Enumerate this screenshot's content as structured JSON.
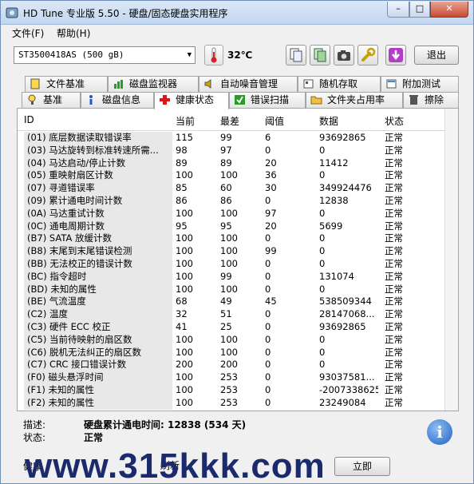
{
  "window": {
    "title": "HD Tune 专业版 5.50 - 硬盘/固态硬盘实用程序",
    "minimize_glyph": "–",
    "maximize_glyph": "□",
    "close_glyph": "✕"
  },
  "menu": {
    "items": [
      "文件(F)",
      "帮助(H)"
    ]
  },
  "toolbar": {
    "drive": "ST3500418AS  (500 gB)",
    "temperature": "32℃",
    "icons": [
      "copy-info-icon",
      "copy-screen-icon",
      "screenshot-icon",
      "options-icon",
      "save-icon"
    ],
    "exit_label": "退出"
  },
  "tabs_top": [
    {
      "label": "文件基准",
      "icon": "file-benchmark-icon"
    },
    {
      "label": "磁盘监视器",
      "icon": "disk-monitor-icon"
    },
    {
      "label": "自动噪音管理",
      "icon": "aam-icon"
    },
    {
      "label": "随机存取",
      "icon": "random-access-icon"
    },
    {
      "label": "附加测试",
      "icon": "extra-tests-icon"
    }
  ],
  "tabs_bottom": [
    {
      "label": "基准",
      "icon": "benchmark-icon"
    },
    {
      "label": "磁盘信息",
      "icon": "info-icon"
    },
    {
      "label": "健康状态",
      "icon": "health-icon",
      "active": true
    },
    {
      "label": "错误扫描",
      "icon": "error-scan-icon"
    },
    {
      "label": "文件夹占用率",
      "icon": "folder-usage-icon"
    },
    {
      "label": "擦除",
      "icon": "erase-icon"
    }
  ],
  "table": {
    "headers": [
      "ID",
      "当前",
      "最差",
      "阈值",
      "数据",
      "状态"
    ],
    "rows": [
      [
        "(01) 底层数据读取错误率",
        "115",
        "99",
        "6",
        "93692865",
        "正常"
      ],
      [
        "(03) 马达旋转到标准转速所需...",
        "98",
        "97",
        "0",
        "0",
        "正常"
      ],
      [
        "(04) 马达启动/停止计数",
        "89",
        "89",
        "20",
        "11412",
        "正常"
      ],
      [
        "(05) 重映射扇区计数",
        "100",
        "100",
        "36",
        "0",
        "正常"
      ],
      [
        "(07) 寻道错误率",
        "85",
        "60",
        "30",
        "349924476",
        "正常"
      ],
      [
        "(09) 累计通电时间计数",
        "86",
        "86",
        "0",
        "12838",
        "正常"
      ],
      [
        "(0A) 马达重试计数",
        "100",
        "100",
        "97",
        "0",
        "正常"
      ],
      [
        "(0C) 通电周期计数",
        "95",
        "95",
        "20",
        "5699",
        "正常"
      ],
      [
        "(B7) SATA 放缓计数",
        "100",
        "100",
        "0",
        "0",
        "正常"
      ],
      [
        "(B8) 末尾到末尾错误检测",
        "100",
        "100",
        "99",
        "0",
        "正常"
      ],
      [
        "(BB) 无法校正的错误计数",
        "100",
        "100",
        "0",
        "0",
        "正常"
      ],
      [
        "(BC) 指令超时",
        "100",
        "99",
        "0",
        "131074",
        "正常"
      ],
      [
        "(BD) 未知的属性",
        "100",
        "100",
        "0",
        "0",
        "正常"
      ],
      [
        "(BE) 气流温度",
        "68",
        "49",
        "45",
        "538509344",
        "正常"
      ],
      [
        "(C2) 温度",
        "32",
        "51",
        "0",
        "28147068...",
        "正常"
      ],
      [
        "(C3) 硬件 ECC 校正",
        "41",
        "25",
        "0",
        "93692865",
        "正常"
      ],
      [
        "(C5) 当前待映射的扇区数",
        "100",
        "100",
        "0",
        "0",
        "正常"
      ],
      [
        "(C6) 脱机无法纠正的扇区数",
        "100",
        "100",
        "0",
        "0",
        "正常"
      ],
      [
        "(C7) CRC 接口错误计数",
        "200",
        "200",
        "0",
        "0",
        "正常"
      ],
      [
        "(F0) 磁头悬浮时间",
        "100",
        "253",
        "0",
        "93037581...",
        "正常"
      ],
      [
        "(F1) 未知的属性",
        "100",
        "253",
        "0",
        "-2007338625",
        "正常"
      ],
      [
        "(F2) 未知的属性",
        "100",
        "253",
        "0",
        "23249084",
        "正常"
      ]
    ]
  },
  "info": {
    "desc_label": "描述:",
    "desc_value": "硬盘累计通电时间: 12838 (534 天)",
    "status_label": "状态:",
    "status_value": "正常"
  },
  "bottom": {
    "refresh_label": "健康",
    "refresh_button": "刷新",
    "now_button": "立即"
  },
  "watermark": "www.315kkk.com"
}
